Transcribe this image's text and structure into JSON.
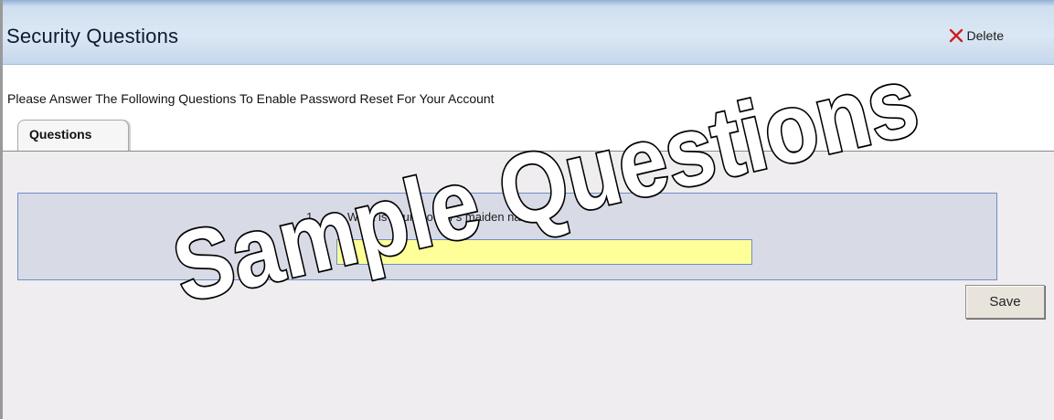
{
  "header": {
    "title": "Security Questions",
    "delete_label": "Delete"
  },
  "instructions": "Please Answer The Following Questions To Enable Password Reset For Your Account",
  "tabs": [
    {
      "label": "Questions",
      "active": true
    }
  ],
  "questions": [
    {
      "number": "1.",
      "text": "What is your mother's maiden name?",
      "answer_value": ""
    }
  ],
  "save_label": "Save",
  "watermark_text": "Sample Questions",
  "colors": {
    "header_blue": "#cfdff0",
    "answer_field": "#ffff99",
    "question_box": "#d8dbe6",
    "delete_icon": "#cc1f1f"
  },
  "icons": [
    "close-icon"
  ]
}
